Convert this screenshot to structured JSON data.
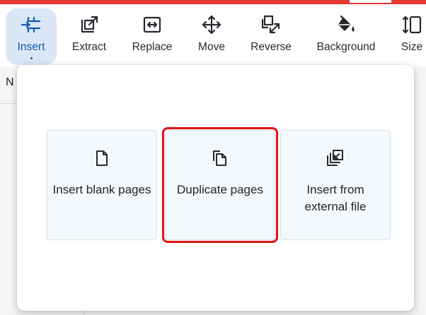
{
  "toolbar": {
    "items": [
      {
        "label": "Insert",
        "icon": "insert-icon",
        "active": true
      },
      {
        "label": "Extract",
        "icon": "extract-icon"
      },
      {
        "label": "Replace",
        "icon": "replace-icon"
      },
      {
        "label": "Move",
        "icon": "move-icon"
      },
      {
        "label": "Reverse",
        "icon": "reverse-icon"
      },
      {
        "label": "Background",
        "icon": "background-icon"
      },
      {
        "label": "Size",
        "icon": "size-icon"
      }
    ]
  },
  "background": {
    "left_stub_text": "N"
  },
  "insert_menu": {
    "options": [
      {
        "label": "Insert blank pages",
        "icon": "blank-page-icon"
      },
      {
        "label": "Duplicate pages",
        "icon": "duplicate-pages-icon",
        "highlighted": true
      },
      {
        "label": "Insert from external file",
        "icon": "external-file-icon"
      }
    ]
  },
  "colors": {
    "accent": "#1558b0",
    "active_bg": "#dbe7f6",
    "card_bg": "#f3f8fd",
    "highlight": "#e11414",
    "top_strip": "#e53935"
  }
}
